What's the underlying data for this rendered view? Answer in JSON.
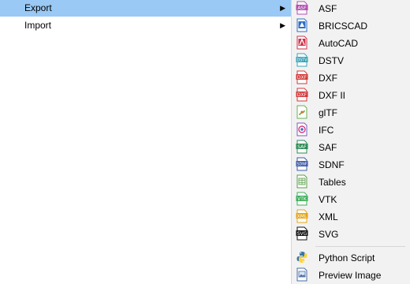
{
  "parent_menu": {
    "items": [
      {
        "label": "Export",
        "has_submenu": true,
        "highlighted": true
      },
      {
        "label": "Import",
        "has_submenu": true,
        "highlighted": false
      }
    ],
    "submenu_arrow": "▶"
  },
  "submenu": {
    "items": [
      {
        "label": "ASF",
        "icon": "asf-file-icon",
        "badge": "ASF",
        "color": "#b14fb1"
      },
      {
        "label": "BRICSCAD",
        "icon": "bricscad-icon",
        "badge": "",
        "color": "#2f6fc6"
      },
      {
        "label": "AutoCAD",
        "icon": "autocad-icon",
        "badge": "",
        "color": "#d0344d"
      },
      {
        "label": "DSTV",
        "icon": "dstv-file-icon",
        "badge": "DSTV",
        "color": "#3aa4b8"
      },
      {
        "label": "DXF",
        "icon": "dxf-file-icon",
        "badge": "DXF",
        "color": "#d23a3a"
      },
      {
        "label": "DXF II",
        "icon": "dxf-ii-file-icon",
        "badge": "DXF",
        "color": "#d23a3a"
      },
      {
        "label": "glTF",
        "icon": "gltf-file-icon",
        "badge": "",
        "color": "#6ab04c"
      },
      {
        "label": "IFC",
        "icon": "ifc-file-icon",
        "badge": "",
        "color": "#7a5cc2"
      },
      {
        "label": "SAF",
        "icon": "saf-file-icon",
        "badge": "SAF",
        "color": "#2e8b57"
      },
      {
        "label": "SDNF",
        "icon": "sdnf-file-icon",
        "badge": "SDNF",
        "color": "#3d5ba9"
      },
      {
        "label": "Tables",
        "icon": "tables-file-icon",
        "badge": "",
        "color": "#5a9e4b"
      },
      {
        "label": "VTK",
        "icon": "vtk-file-icon",
        "badge": "VTK",
        "color": "#3fae5a"
      },
      {
        "label": "XML",
        "icon": "xml-file-icon",
        "badge": "XML",
        "color": "#e5a417"
      },
      {
        "label": "SVG",
        "icon": "svg-file-icon",
        "badge": "SVG",
        "color": "#111111"
      },
      {
        "label": "Python Script",
        "icon": "python-icon",
        "badge": "",
        "color": "#3776ab"
      },
      {
        "label": "Preview Image",
        "icon": "preview-image-icon",
        "badge": "",
        "color": "#4a6da7"
      }
    ]
  }
}
